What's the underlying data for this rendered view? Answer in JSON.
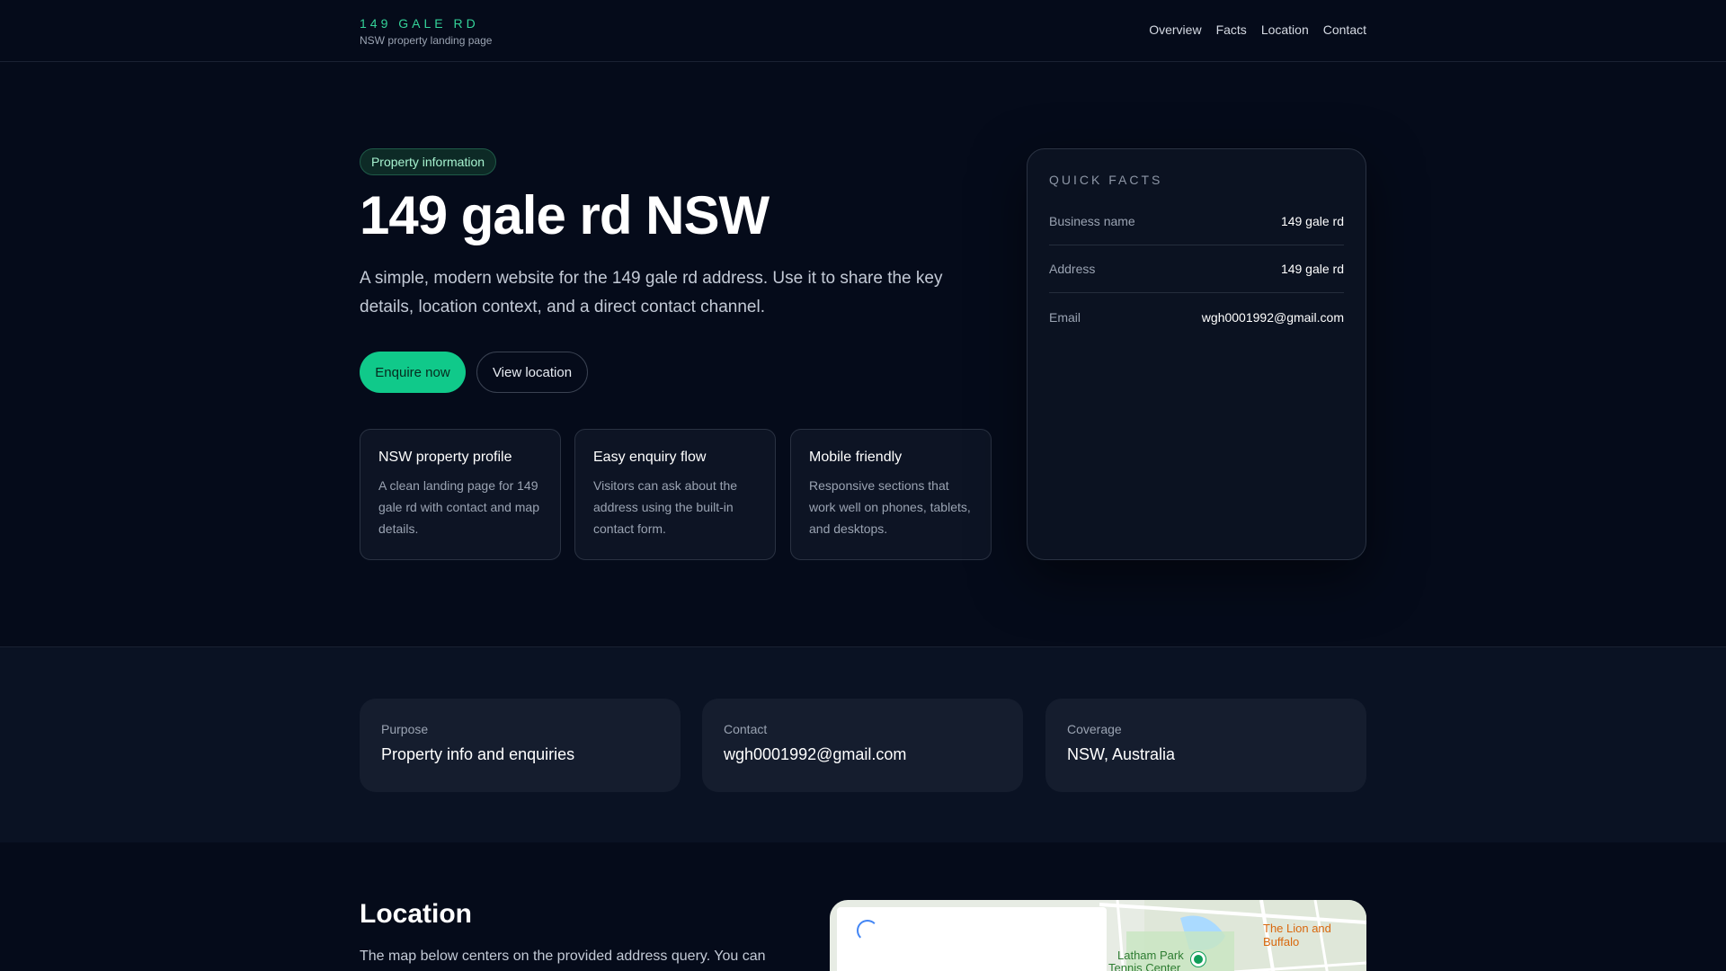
{
  "header": {
    "brand_title": "149 GALE RD",
    "brand_subtitle": "NSW property landing page",
    "nav": [
      "Overview",
      "Facts",
      "Location",
      "Contact"
    ]
  },
  "hero": {
    "badge": "Property information",
    "title": "149 gale rd NSW",
    "description": "A simple, modern website for the 149 gale rd address. Use it to share the key details, location context, and a direct contact channel.",
    "primary_button": "Enquire now",
    "secondary_button": "View location",
    "features": [
      {
        "title": "NSW property profile",
        "text": "A clean landing page for 149 gale rd with contact and map details."
      },
      {
        "title": "Easy enquiry flow",
        "text": "Visitors can ask about the address using the built-in contact form."
      },
      {
        "title": "Mobile friendly",
        "text": "Responsive sections that work well on phones, tablets, and desktops."
      }
    ]
  },
  "quick_facts": {
    "title": "QUICK FACTS",
    "rows": [
      {
        "label": "Business name",
        "value": "149 gale rd"
      },
      {
        "label": "Address",
        "value": "149 gale rd"
      },
      {
        "label": "Email",
        "value": "wgh0001992@gmail.com"
      }
    ]
  },
  "info_cards": [
    {
      "label": "Purpose",
      "value": "Property info and enquiries"
    },
    {
      "label": "Contact",
      "value": "wgh0001992@gmail.com"
    },
    {
      "label": "Coverage",
      "value": "NSW, Australia"
    }
  ],
  "location": {
    "title": "Location",
    "description": "The map below centers on the provided address query. You can",
    "map_labels": {
      "poi": "The Lion and Buffalo",
      "park": "Latham Park",
      "park2": "Tennis Center"
    }
  },
  "colors": {
    "accent": "#10c98a",
    "background": "#050b1a"
  }
}
